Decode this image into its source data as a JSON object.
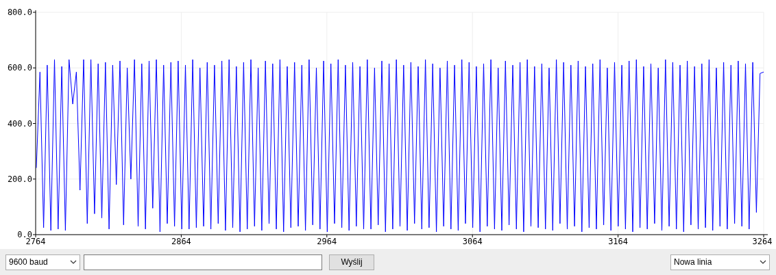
{
  "chart_data": {
    "type": "line",
    "grid": true,
    "xlim": [
      2764,
      3264
    ],
    "ylim": [
      0,
      800
    ],
    "xticks": [
      {
        "value": 2764,
        "label": "2764"
      },
      {
        "value": 2864,
        "label": "2864"
      },
      {
        "value": 2964,
        "label": "2964"
      },
      {
        "value": 3064,
        "label": "3064"
      },
      {
        "value": 3164,
        "label": "3164"
      },
      {
        "value": 3264,
        "label": "3264"
      }
    ],
    "yticks": [
      {
        "value": 800,
        "label": "800.0"
      },
      {
        "value": 600,
        "label": "600.0"
      },
      {
        "value": 400,
        "label": "400.0"
      },
      {
        "value": 200,
        "label": "200.0"
      },
      {
        "value": 0,
        "label": "0.0"
      }
    ],
    "x": [
      2764,
      2766.5,
      2769,
      2771.5,
      2774,
      2776.5,
      2779,
      2781.5,
      2784,
      2786.5,
      2789,
      2791.5,
      2794,
      2796.5,
      2799,
      2801.5,
      2804,
      2806.5,
      2809,
      2811.5,
      2814,
      2816.5,
      2819,
      2821.5,
      2824,
      2826.5,
      2829,
      2831.5,
      2834,
      2836.5,
      2839,
      2841.5,
      2844,
      2846.5,
      2849,
      2851.5,
      2854,
      2856.5,
      2859,
      2861.5,
      2864,
      2866.5,
      2869,
      2871.5,
      2874,
      2876.5,
      2879,
      2881.5,
      2884,
      2886.5,
      2889,
      2891.5,
      2894,
      2896.5,
      2899,
      2901.5,
      2904,
      2906.5,
      2909,
      2911.5,
      2914,
      2916.5,
      2919,
      2921.5,
      2924,
      2926.5,
      2929,
      2931.5,
      2934,
      2936.5,
      2939,
      2941.5,
      2944,
      2946.5,
      2949,
      2951.5,
      2954,
      2956.5,
      2959,
      2961.5,
      2964,
      2966.5,
      2969,
      2971.5,
      2974,
      2976.5,
      2979,
      2981.5,
      2984,
      2986.5,
      2989,
      2991.5,
      2994,
      2996.5,
      2999,
      3001.5,
      3004,
      3006.5,
      3009,
      3011.5,
      3014,
      3016.5,
      3019,
      3021.5,
      3024,
      3026.5,
      3029,
      3031.5,
      3034,
      3036.5,
      3039,
      3041.5,
      3044,
      3046.5,
      3049,
      3051.5,
      3054,
      3056.5,
      3059,
      3061.5,
      3064,
      3066.5,
      3069,
      3071.5,
      3074,
      3076.5,
      3079,
      3081.5,
      3084,
      3086.5,
      3089,
      3091.5,
      3094,
      3096.5,
      3099,
      3101.5,
      3104,
      3106.5,
      3109,
      3111.5,
      3114,
      3116.5,
      3119,
      3121.5,
      3124,
      3126.5,
      3129,
      3131.5,
      3134,
      3136.5,
      3139,
      3141.5,
      3144,
      3146.5,
      3149,
      3151.5,
      3154,
      3156.5,
      3159,
      3161.5,
      3164,
      3166.5,
      3169,
      3171.5,
      3174,
      3176.5,
      3179,
      3181.5,
      3184,
      3186.5,
      3189,
      3191.5,
      3194,
      3196.5,
      3199,
      3201.5,
      3204,
      3206.5,
      3209,
      3211.5,
      3214,
      3216.5,
      3219,
      3221.5,
      3224,
      3226.5,
      3229,
      3231.5,
      3234,
      3236.5,
      3239,
      3241.5,
      3244,
      3246.5,
      3249,
      3251.5,
      3254,
      3256.5,
      3259,
      3261.5,
      3264
    ],
    "series": [
      {
        "color": "#0000ff",
        "values": [
          240,
          585,
          25,
          610,
          15,
          630,
          20,
          605,
          15,
          630,
          470,
          585,
          160,
          630,
          40,
          630,
          75,
          615,
          60,
          620,
          20,
          610,
          180,
          625,
          35,
          600,
          200,
          630,
          30,
          615,
          20,
          625,
          95,
          630,
          10,
          610,
          40,
          620,
          30,
          625,
          20,
          610,
          20,
          630,
          25,
          600,
          30,
          620,
          20,
          610,
          40,
          625,
          15,
          630,
          25,
          605,
          10,
          620,
          20,
          630,
          30,
          600,
          15,
          625,
          40,
          615,
          20,
          630,
          10,
          605,
          25,
          620,
          30,
          610,
          15,
          630,
          35,
          600,
          20,
          625,
          10,
          615,
          40,
          630,
          25,
          610,
          15,
          620,
          30,
          605,
          20,
          630,
          20,
          600,
          35,
          625,
          10,
          615,
          20,
          630,
          30,
          610,
          15,
          620,
          40,
          605,
          20,
          630,
          25,
          615,
          10,
          600,
          30,
          625,
          20,
          610,
          15,
          630,
          40,
          620,
          25,
          605,
          10,
          615,
          30,
          630,
          20,
          600,
          15,
          625,
          35,
          610,
          20,
          620,
          10,
          630,
          30,
          605,
          25,
          615,
          20,
          600,
          15,
          630,
          40,
          620,
          20,
          610,
          30,
          625,
          10,
          605,
          25,
          615,
          20,
          630,
          35,
          600,
          15,
          620,
          30,
          610,
          20,
          625,
          10,
          630,
          25,
          605,
          20,
          615,
          40,
          600,
          15,
          630,
          30,
          620,
          20,
          610,
          10,
          625,
          35,
          605,
          20,
          615,
          25,
          630,
          15,
          600,
          30,
          620,
          20,
          610,
          40,
          625,
          30,
          615,
          20,
          620,
          80,
          580,
          585
        ]
      }
    ]
  },
  "toolbar": {
    "baud_select": "9600 baud",
    "send_button": "Wyślij",
    "line_ending_select": "Nowa linia"
  }
}
